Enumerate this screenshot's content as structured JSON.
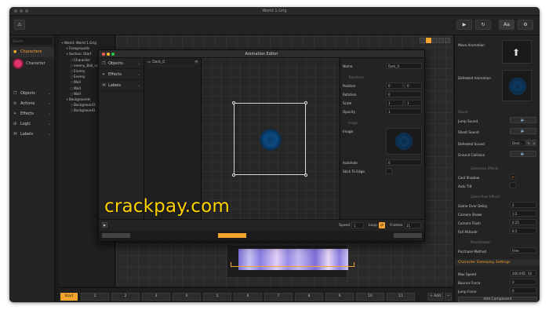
{
  "window": {
    "title": "World 1.Grig",
    "left_icon": "warning-icon"
  },
  "toolbar": {
    "play_icon": "play-icon",
    "refresh_icon": "refresh-icon",
    "text_label": "Aa",
    "settings_icon": "gear-icon"
  },
  "sidebar": {
    "search_placeholder": "Search",
    "items": [
      {
        "label": "Characters",
        "icon": "person-icon"
      },
      {
        "label": "Objects",
        "icon": "cube-icon"
      },
      {
        "label": "Actions",
        "icon": "gear-icon"
      },
      {
        "label": "Effects",
        "icon": "star-icon"
      },
      {
        "label": "Logic",
        "icon": "logic-icon"
      },
      {
        "label": "Labels",
        "icon": "tag-icon"
      }
    ],
    "gallery_item": "Character"
  },
  "hierarchy": {
    "rows": [
      {
        "text": "World: World 1.Grig",
        "indent": 0
      },
      {
        "text": "Foregrounds",
        "indent": 1
      },
      {
        "text": "Section: Start",
        "indent": 1
      },
      {
        "text": "Character",
        "indent": 2
      },
      {
        "text": "enemy_Ball_ro...",
        "indent": 2
      },
      {
        "text": "Enemy",
        "indent": 2
      },
      {
        "text": "Enemy",
        "indent": 2
      },
      {
        "text": "Wall",
        "indent": 2
      },
      {
        "text": "Wall",
        "indent": 2
      },
      {
        "text": "Wall",
        "indent": 2
      },
      {
        "text": "Backgrounds",
        "indent": 1
      },
      {
        "text": "Background3",
        "indent": 2
      },
      {
        "text": "Background1",
        "indent": 2
      }
    ]
  },
  "inspector": {
    "move_animation": "Move Animation",
    "defeated_animation": "Defeated Animation",
    "sound_header": "Sound",
    "jump_sound": "Jump Sound",
    "shoot_sound": "Shoot Sound",
    "defeated_sound": "Defeated Sound",
    "defeated_sound_value": "Deat...",
    "ground_collision": "Ground Collision",
    "gameplay_effects_header": "Gameplay Effects",
    "cast_shadow": "Cast Shadow",
    "auto_tilt": "Auto Tilt",
    "game_over_header": "Game Over Effects",
    "game_over_delay": "Game Over Delay",
    "game_over_delay_value": "2",
    "camera_shake": "Camera Shake",
    "camera_shake_value": "1.5",
    "camera_flash": "Camera Flash",
    "camera_flash_value": "0.25",
    "fall_altitude": "Fall Altitude",
    "fall_altitude_value": "0.5",
    "monetization_header": "Monetization",
    "purchase_method": "Purchase Method",
    "purchase_method_value": "Free",
    "gameplay_settings": "Character Gameplay Settings",
    "max_speed": "Max Speed",
    "max_speed_value": "200.001",
    "max_speed_value2": "50",
    "bounce_force": "Bounce Force",
    "bounce_force_value": "0",
    "jump_force": "Jump Force",
    "jump_force_value": "0",
    "add_component": "Add Component"
  },
  "timeline": {
    "start": "Start",
    "slots": [
      "1",
      "2",
      "3",
      "4",
      "5",
      "6",
      "7",
      "8",
      "9",
      "10",
      "11"
    ],
    "add_label": "Add"
  },
  "modal": {
    "title": "Animation Editor",
    "categories": [
      {
        "label": "Objects",
        "icon": "cube-icon"
      },
      {
        "label": "Effects",
        "icon": "star-icon"
      },
      {
        "label": "Labels",
        "icon": "tag-icon"
      }
    ],
    "list_item": "Dark_0",
    "props": {
      "name_label": "Name",
      "name_value": "Dark_0",
      "transform_header": "Transform",
      "position_label": "Position",
      "position_x": "0",
      "position_y": "0",
      "rotation_label": "Rotation",
      "rotation_value": "0",
      "scale_label": "Scale",
      "scale_x": "1",
      "scale_y": "1",
      "opacity_label": "Opacity",
      "opacity_value": "1",
      "image_header": "Image",
      "image_label": "Image",
      "autohide_label": "Autohide",
      "autohide_value": "0",
      "stick_label": "Stick To Edge"
    },
    "speed_label": "Speed",
    "speed_value": "1",
    "loop_label": "Loop",
    "frames_label": "Frames",
    "frames_value": "11"
  },
  "watermark": "crackpay.com",
  "colors": {
    "accent": "#f4a52e",
    "bg": "#1b1b1b",
    "ball": "#e0356b"
  }
}
